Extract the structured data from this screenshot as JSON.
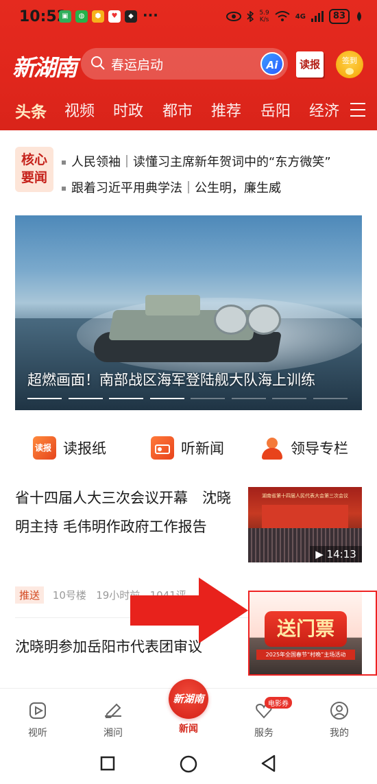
{
  "status": {
    "time": "10:52",
    "more": "···",
    "speed": "5.9\nK/s",
    "network": "4G",
    "battery": "83"
  },
  "header": {
    "logo": "新湖南",
    "search_placeholder": "春运启动",
    "ai_label": "Ai",
    "paper_label": "读报",
    "sign_label": "签到"
  },
  "channels": [
    "头条",
    "视频",
    "时政",
    "都市",
    "推荐",
    "岳阳",
    "经济"
  ],
  "core_news": {
    "badge": "核心\n要闻",
    "items": [
      "人民领袖｜读懂习主席新年贺词中的“东方微笑”",
      "跟着习近平用典学法｜公生明，廉生威"
    ]
  },
  "banner": {
    "title": "超燃画面！南部战区海军登陆舰大队海上训练",
    "slide_count": 8,
    "active_slide": 4
  },
  "quick_entries": [
    {
      "label": "读报纸",
      "icon": "newspaper-icon"
    },
    {
      "label": "听新闻",
      "icon": "radio-icon"
    },
    {
      "label": "领导专栏",
      "icon": "leader-icon"
    }
  ],
  "articles": [
    {
      "title": "省十四届人大三次会议开幕　沈晓明主持  毛伟明作政府工作报告",
      "tag": "推送",
      "source": "10号楼",
      "time": "19小时前",
      "views": "1041评",
      "duration": "14:13",
      "thumb_caption": "湖南省第十四届人民代表大会第三次会议"
    },
    {
      "title": "沈晓明参加岳阳市代表团审议",
      "thumb_caption": "送门票",
      "thumb_subcaption": "2025年全国春节“村晚”主场活动"
    }
  ],
  "bottom_nav": [
    {
      "label": "视听",
      "icon": "video-play-icon"
    },
    {
      "label": "湘问",
      "icon": "chat-edit-icon"
    },
    {
      "label": "新闻",
      "icon": "app-logo-icon",
      "center_text": "新湖南"
    },
    {
      "label": "服务",
      "icon": "heart-service-icon",
      "badge": "电影券"
    },
    {
      "label": "我的",
      "icon": "user-icon"
    }
  ],
  "colors": {
    "brand_red": "#e0261c",
    "active_channel": "#ffe9c2",
    "tag_text": "#d2481f"
  }
}
